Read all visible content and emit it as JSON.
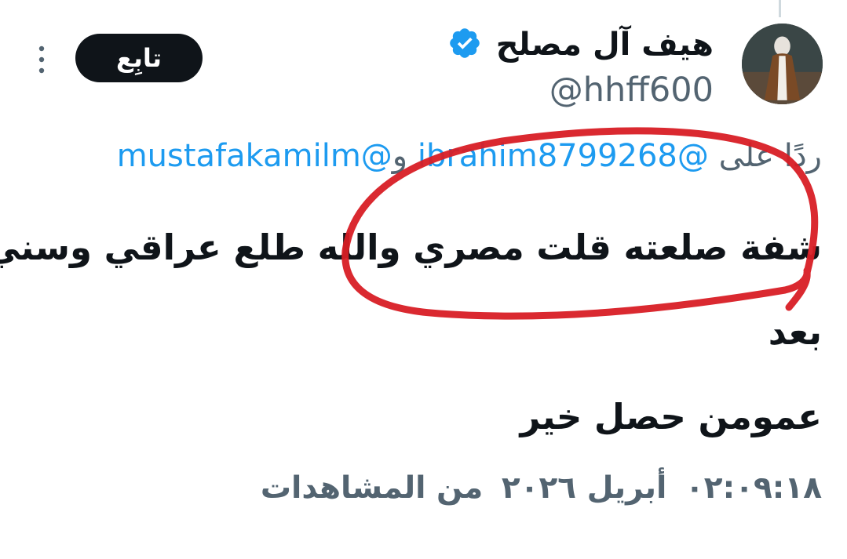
{
  "tweet": {
    "author_name": "هيف آل مصلح",
    "handle": "@hhff600",
    "verified": true,
    "follow_label": "تابِع",
    "more_icon": "more-vertical-icon",
    "reply": {
      "prefix": "ردًا على",
      "mentions": [
        "@ibrahim8799268",
        "@mustafakamilm"
      ],
      "conjunction": "و"
    },
    "text_lines": [
      "شفة صلعته قلت مصري والله طلع عراقي وسني",
      "بعد",
      "عمومن حصل خير"
    ],
    "meta": {
      "time": "٠٢:٠٩:١٨",
      "date": "أبريل ٢٠٢٦",
      "views_label": "من المشاهدات"
    }
  },
  "colors": {
    "accent": "#1d9bf0",
    "text": "#0f1419",
    "secondary": "#536471",
    "annotation": "#d81e25"
  }
}
